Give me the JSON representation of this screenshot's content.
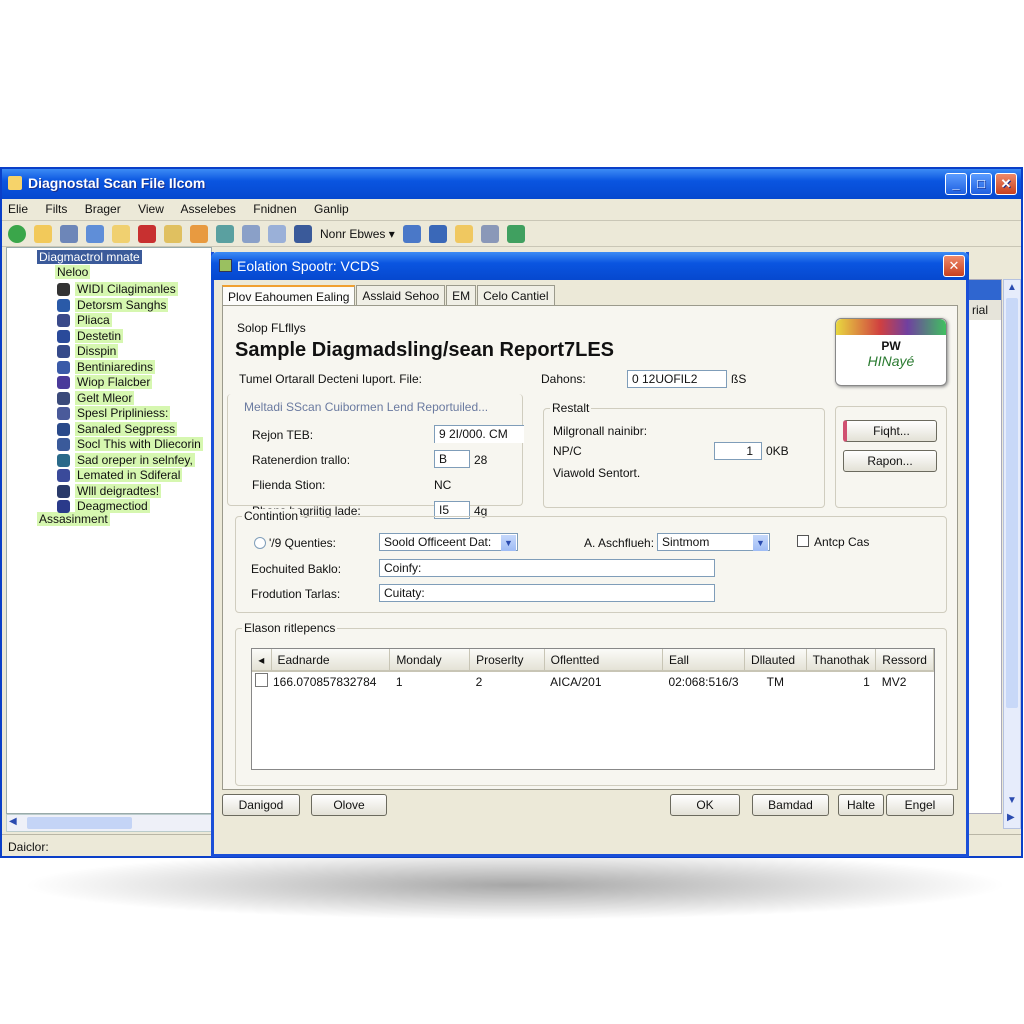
{
  "main_window": {
    "title": "Diagnostal Scan File Ilcom",
    "menu": [
      "Elie",
      "Filts",
      "Brager",
      "View",
      "Asselebes",
      "Fnidnen",
      "Ganlip"
    ],
    "toolbar_dropdown": "Nonr Ebwes",
    "status": "Daiclor:",
    "right_pane_item": "rial"
  },
  "tree": {
    "root": "Diagmactrol mnate",
    "group": "Neloo",
    "items": [
      "WIDI Cilagimanles",
      "Detorsm Sanghs",
      "Pliaca",
      "Destetin",
      "Disspin",
      "Bentiniaredins",
      "Wiop Flalcber",
      "Gelt Mleor",
      "Spesl Pripliniess:",
      "Sanaled Segpress",
      "Socl This with Dliecorin",
      "Sad oreper in selnfey,",
      "Lemated in Sdiferal",
      "Wlll deigradtes!",
      "Deagmectiod"
    ],
    "last": "Assasinment"
  },
  "dialog": {
    "title": "Eolation Spootr: VCDS",
    "tabs": [
      "Plov Eahoumen Ealing",
      "Asslaid Sehoo",
      "EM",
      "Celo Cantiel"
    ],
    "subtitle": "Solop FLfllys",
    "heading": "Sample Diagmadsling/sean Report7LES",
    "file_label": "Tumel Ortarall Decteni Iuport. File:",
    "dahons_label": "Dahons:",
    "dahons_value": "0     12UOFIL2",
    "dahons_unit": "ßS",
    "logo": {
      "line1": "PW",
      "line2": "HINayé"
    },
    "left_group": {
      "title": "Meltadi SScan Cuibormen Lend Reportuiled...",
      "rows": [
        {
          "label": "Rejon TEB:",
          "value": "9   2I/000. CM",
          "unit": ""
        },
        {
          "label": "Ratenerdion trallo:",
          "value": "B",
          "unit": "28"
        },
        {
          "label": "Flienda Stion:",
          "value": "NC",
          "unit": ""
        },
        {
          "label": "Phans bagriitig lade:",
          "value": "I5",
          "unit": "4g"
        }
      ]
    },
    "restalt_group": {
      "title": "Restalt",
      "rows": [
        "Milgronall nainibr:",
        "NP/C",
        "Viawold Sentort."
      ],
      "value": "1",
      "unit": "0KB"
    },
    "side_buttons": [
      "Fiqht...",
      "Rapon..."
    ],
    "contintion": {
      "title": "Contintion",
      "radio_label": "'/9 Quenties:",
      "select1": "Soold Officeent Dat:",
      "select2_label": "A.  Aschflueh:",
      "select2": "Sintmom",
      "checkbox_label": "Antcp Cas",
      "field1_label": "Eochuited Baklo:",
      "field1": "Coinfy:",
      "field2_label": "Frodution Tarlas:",
      "field2": "Cuitaty:"
    },
    "table": {
      "title": "Elason ritlepencs",
      "columns": [
        "Eadnarde",
        "Mondaly",
        "Proserlty",
        "Oflentted",
        "Eall",
        "Dllauted",
        "Thanothak",
        "Ressord"
      ],
      "rows": [
        [
          "166.070857832784",
          "1",
          "2",
          "AICA/201",
          "02:068:516/3",
          "TM",
          "1",
          "MV2"
        ]
      ]
    },
    "buttons": [
      "Danigod",
      "Olove",
      "OK",
      "Bamdad",
      "Halte",
      "Engel"
    ]
  }
}
